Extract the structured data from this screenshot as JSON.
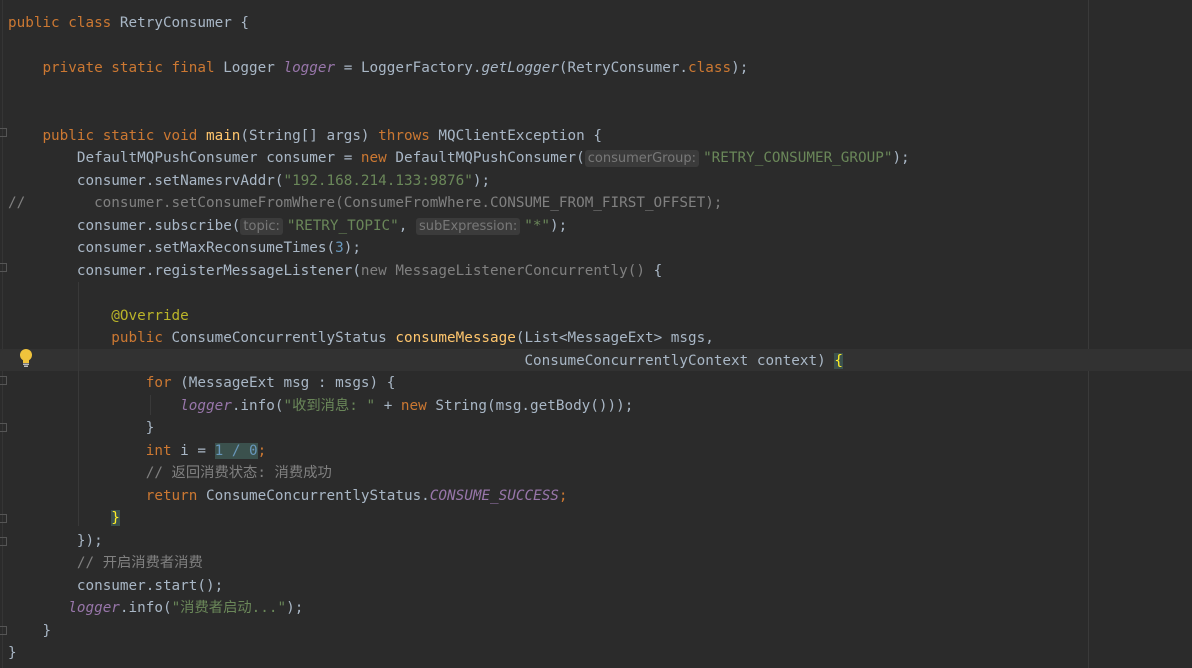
{
  "lines": [
    {
      "id": "l1"
    },
    {
      "id": "l2"
    }
  ],
  "code": {
    "class_kw": "public class",
    "class_name": " RetryConsumer {",
    "field_mods": "private static final",
    "field_type": " Logger ",
    "field_name": "logger",
    "field_eq": " = LoggerFactory.",
    "field_call": "getLogger",
    "field_arg": "(RetryConsumer.",
    "field_class_kw": "class",
    "field_end": ");",
    "main_mods": "public static void",
    "main_name": "main",
    "main_params": "(String[] args) ",
    "main_throws": "throws",
    "main_exc": " MQClientException {",
    "l6_a": "DefaultMQPushConsumer consumer = ",
    "l6_new": "new",
    "l6_b": " DefaultMQPushConsumer(",
    "l6_hint": "consumerGroup:",
    "l6_str": "\"RETRY_CONSUMER_GROUP\"",
    "l6_end": ");",
    "l7_a": "consumer.setNamesrvAddr(",
    "l7_str": "\"192.168.214.133:9876\"",
    "l7_end": ");",
    "l8_comment": "//        consumer.setConsumeFromWhere(ConsumeFromWhere.CONSUME_FROM_FIRST_OFFSET);",
    "l9_a": "consumer.subscribe(",
    "l9_hint1": "topic:",
    "l9_str1": "\"RETRY_TOPIC\"",
    "l9_comma": ", ",
    "l9_hint2": "subExpression:",
    "l9_str2": "\"*\"",
    "l9_end": ");",
    "l10_a": "consumer.setMaxReconsumeTimes(",
    "l10_num": "3",
    "l10_end": ");",
    "l11_a": "consumer.registerMessageListener(",
    "l11_gray": "new MessageListenerConcurrently()",
    "l11_end": " {",
    "l12_ann": "@Override",
    "l13_kw": "public",
    "l13_type": " ConsumeConcurrentlyStatus ",
    "l13_fn": "consumeMessage",
    "l13_params": "(List<MessageExt> msgs,",
    "l14_params": "ConsumeConcurrentlyContext context) ",
    "l14_brace": "{",
    "l15_for": "for",
    "l15_rest": " (MessageExt msg : msgs) {",
    "l16_fld": "logger",
    "l16_a": ".info(",
    "l16_str": "\"收到消息: \"",
    "l16_plus": " + ",
    "l16_new": "new",
    "l16_rest": " String(msg.getBody()));",
    "l17": "}",
    "l18_int": "int",
    "l18_a": " i = ",
    "l18_expr": "1 / 0",
    "l18_end": ";",
    "l19_cmt": "// 返回消费状态: 消费成功",
    "l20_ret": "return",
    "l20_a": " ConsumeConcurrentlyStatus.",
    "l20_const": "CONSUME_SUCCESS",
    "l20_end": ";",
    "l21_brace": "}",
    "l22": "});",
    "l23_cmt": "// 开启消费者消费",
    "l24": "consumer.start();",
    "l25_fld": "logger",
    "l25_a": ".info(",
    "l25_str": "\"消费者启动...\"",
    "l25_end": ");",
    "l26": "}",
    "l27": "}"
  }
}
